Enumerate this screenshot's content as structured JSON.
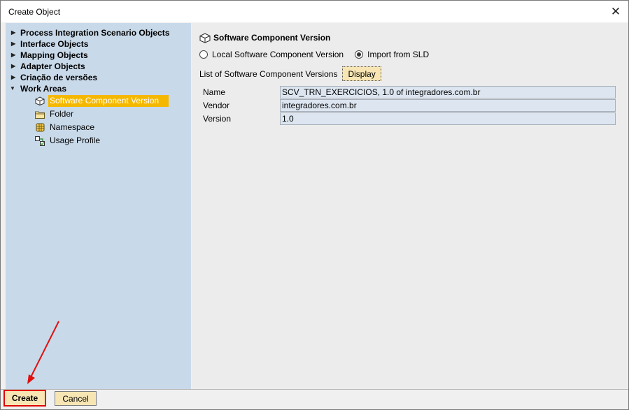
{
  "window": {
    "title": "Create Object",
    "close_glyph": "✕"
  },
  "sidebar": {
    "tree": [
      {
        "label": "Process Integration Scenario Objects",
        "expanded": false
      },
      {
        "label": "Interface Objects",
        "expanded": false
      },
      {
        "label": "Mapping Objects",
        "expanded": false
      },
      {
        "label": "Adapter Objects",
        "expanded": false
      },
      {
        "label": "Criação de versões",
        "expanded": false
      },
      {
        "label": "Work Areas",
        "expanded": true
      }
    ],
    "work_areas": [
      {
        "label": "Software Component Version",
        "icon": "software-component-icon",
        "selected": true
      },
      {
        "label": "Folder",
        "icon": "folder-icon",
        "selected": false
      },
      {
        "label": "Namespace",
        "icon": "namespace-icon",
        "selected": false
      },
      {
        "label": "Usage Profile",
        "icon": "usage-profile-icon",
        "selected": false
      }
    ]
  },
  "main": {
    "heading": "Software Component Version",
    "radio_local": "Local Software Component Version",
    "radio_import": "Import from SLD",
    "selected_option": "Import from SLD",
    "list_label": "List of Software Component Versions",
    "display_button": "Display",
    "fields": [
      {
        "label": "Name",
        "value": "SCV_TRN_EXERCICIOS, 1.0 of integradores.com.br"
      },
      {
        "label": "Vendor",
        "value": "integradores.com.br"
      },
      {
        "label": "Version",
        "value": "1.0"
      }
    ]
  },
  "footer": {
    "create_button": "Create",
    "cancel_button": "Cancel"
  },
  "colors": {
    "sidebar_bg": "#c8d9e9",
    "selection": "#f5b800",
    "button_bg": "#f7e6b4",
    "highlight_red": "#e00000"
  }
}
